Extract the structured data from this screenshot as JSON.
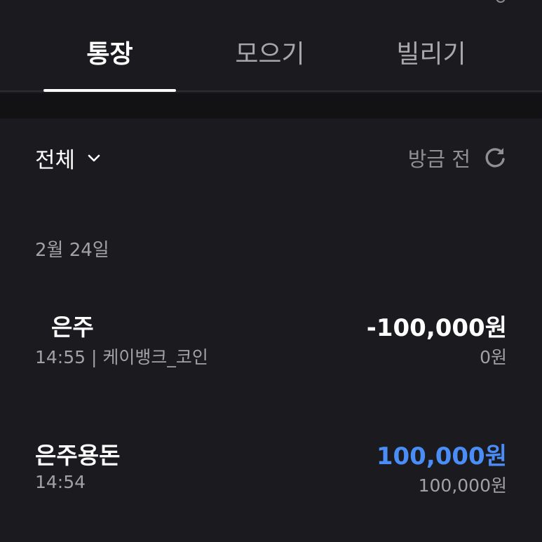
{
  "tabs": {
    "account": "통장",
    "saving": "모으기",
    "loan": "빌리기",
    "active": "account"
  },
  "filter": {
    "label": "전체"
  },
  "refresh": {
    "updated_text": "방금 전"
  },
  "date_header": "2월 24일",
  "transactions": [
    {
      "name": "  은주",
      "detail": "14:55 | 케이뱅크_코인",
      "amount": "-100,000원",
      "balance": "0원"
    },
    {
      "name": "은주용돈",
      "detail": "14:54",
      "amount": "100,000원",
      "balance": "100,000원"
    }
  ],
  "colors": {
    "background": "#1b1b1f",
    "divider": "#121214",
    "positive_amount": "#4b8df6",
    "secondary_text": "#a1a1a7"
  }
}
